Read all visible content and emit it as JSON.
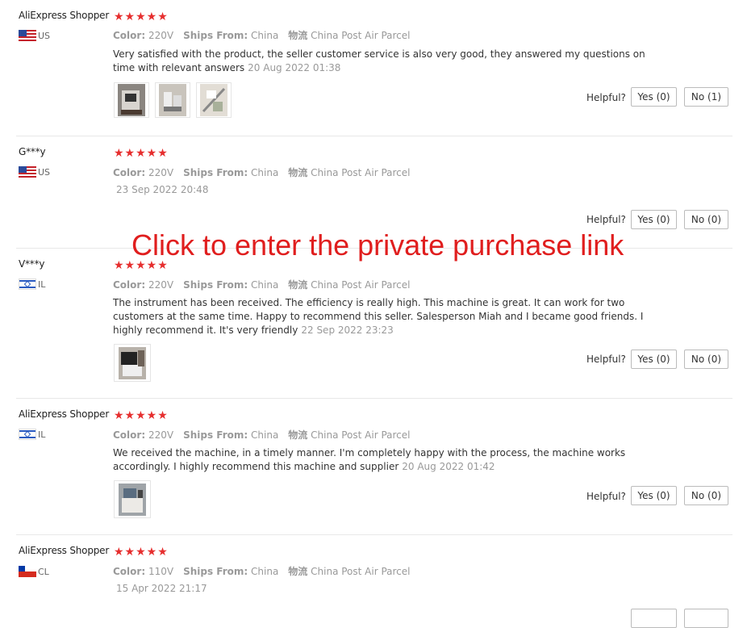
{
  "overlay_text": "Click to enter the private purchase link",
  "labels": {
    "color": "Color:",
    "ships_from": "Ships From:",
    "logistics": "物流",
    "helpful": "Helpful?"
  },
  "reviews": [
    {
      "user": "AliExpress Shopper",
      "country": "US",
      "flag": "us",
      "rating": 5,
      "stars": "★★★★★",
      "color": "220V",
      "ships_from": "China",
      "logistics": "China Post Air Parcel",
      "text": "Very satisfied with the product, the seller customer service is also very good, they answered my questions on time with relevant answers",
      "date": "20 Aug 2022 01:38",
      "yes": "Yes (0)",
      "no": "No (1)",
      "photos": 3
    },
    {
      "user": "G***y",
      "country": "US",
      "flag": "us",
      "rating": 5,
      "stars": "★★★★★",
      "color": "220V",
      "ships_from": "China",
      "logistics": "China Post Air Parcel",
      "text": "",
      "date": "23 Sep 2022 20:48",
      "yes": "Yes (0)",
      "no": "No (0)",
      "photos": 0
    },
    {
      "user": "V***y",
      "country": "IL",
      "flag": "il",
      "rating": 5,
      "stars": "★★★★★",
      "color": "220V",
      "ships_from": "China",
      "logistics": "China Post Air Parcel",
      "text": "The instrument has been received. The efficiency is really high. This machine is great. It can work for two customers at the same time. Happy to recommend this seller. Salesperson Miah and I became good friends. I highly recommend it. It's very friendly",
      "date": "22 Sep 2022 23:23",
      "yes": "Yes (0)",
      "no": "No (0)",
      "photos": 1
    },
    {
      "user": "AliExpress Shopper",
      "country": "IL",
      "flag": "il",
      "rating": 5,
      "stars": "★★★★★",
      "color": "220V",
      "ships_from": "China",
      "logistics": "China Post Air Parcel",
      "text": "We received the machine, in a timely manner. I'm completely happy with the process, the machine works accordingly. I highly recommend this machine and supplier",
      "date": "20 Aug 2022 01:42",
      "yes": "Yes (0)",
      "no": "No (0)",
      "photos": 1
    },
    {
      "user": "AliExpress Shopper",
      "country": "CL",
      "flag": "cl",
      "rating": 5,
      "stars": "★★★★★",
      "color": "110V",
      "ships_from": "China",
      "logistics": "China Post Air Parcel",
      "text": "",
      "date": "15 Apr 2022 21:17",
      "yes": "",
      "no": "",
      "photos": 0
    }
  ]
}
